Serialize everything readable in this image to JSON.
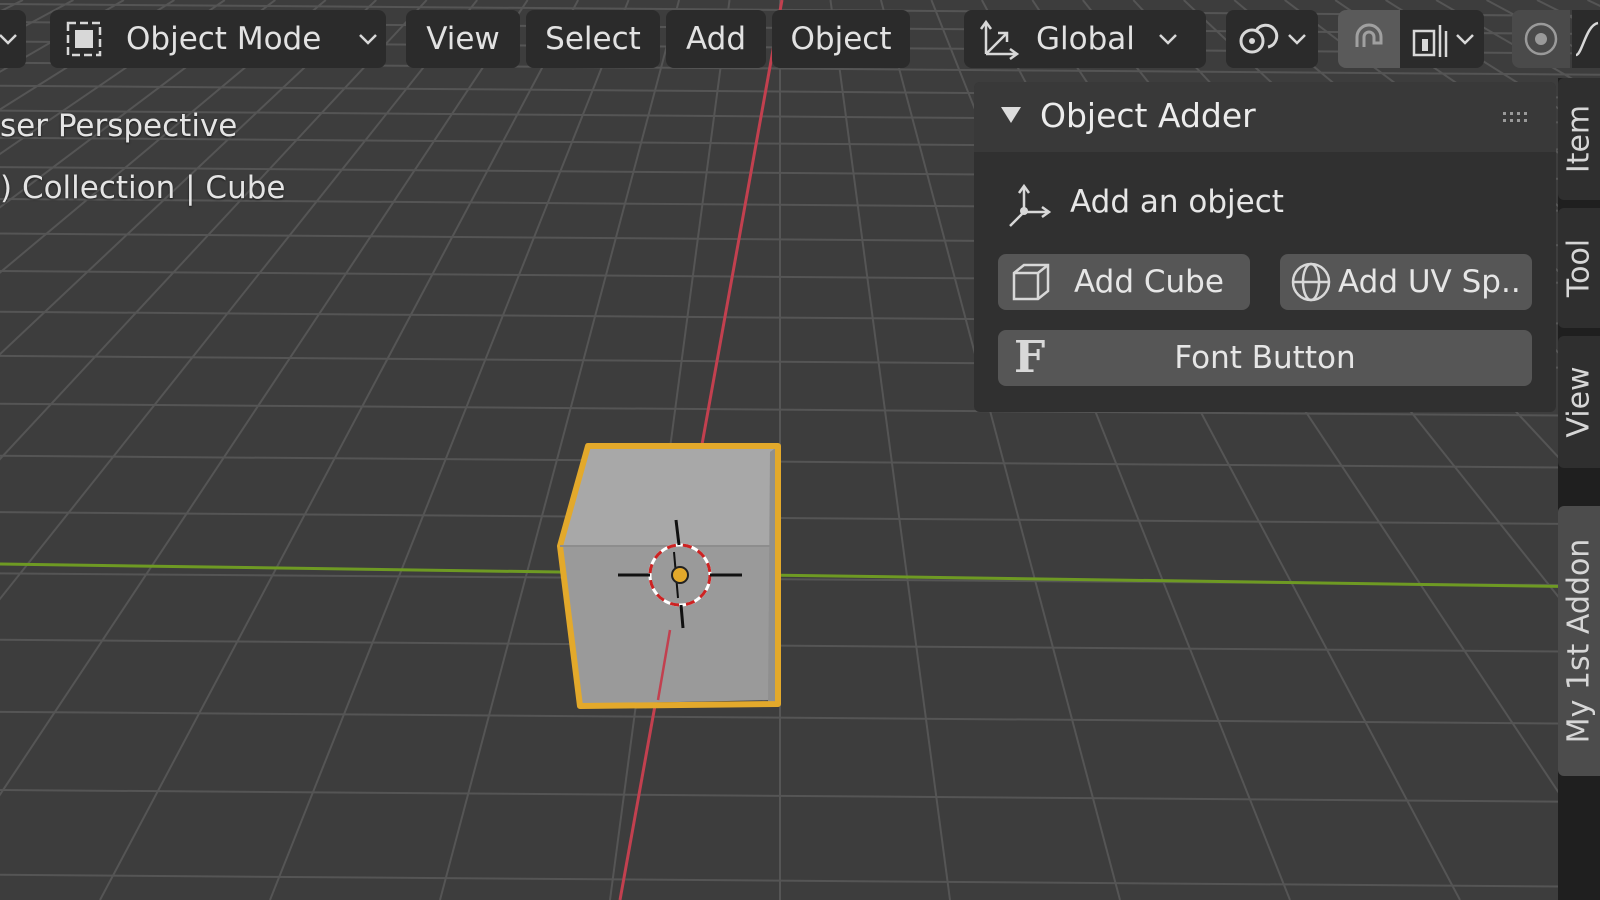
{
  "header": {
    "mode_label": "Object Mode",
    "menus": [
      "View",
      "Select",
      "Add",
      "Object"
    ],
    "transform_orientation": "Global"
  },
  "overlay": {
    "perspective": "ser Perspective",
    "collection_info": ") Collection | Cube"
  },
  "panel": {
    "title": "Object Adder",
    "subtitle": "Add an object",
    "add_cube_label": "Add Cube",
    "add_uv_sphere_label": "Add UV Sp..",
    "font_button_label": "Font Button",
    "font_glyph": "F"
  },
  "tabs": [
    "Item",
    "Tool",
    "View",
    "My 1st Addon"
  ],
  "colors": {
    "viewport_bg": "#3d3d3d",
    "grid": "#555555",
    "x_axis": "#c2404f",
    "y_axis": "#6e9a23",
    "selection_outline": "#e3a92b",
    "cube_face": "#9c9c9c",
    "origin_dot": "#e3a92b"
  },
  "icons": {
    "mode": "object-mode-icon",
    "orientation": "transform-orientation-icon",
    "pivot": "pivot-link-icon",
    "snap": "snap-magnet-icon",
    "snap_target": "snap-increment-icon",
    "proportional": "proportional-editing-icon",
    "cursor_tool": "add-object-icon",
    "cube": "cube-icon",
    "sphere": "uv-sphere-icon"
  }
}
